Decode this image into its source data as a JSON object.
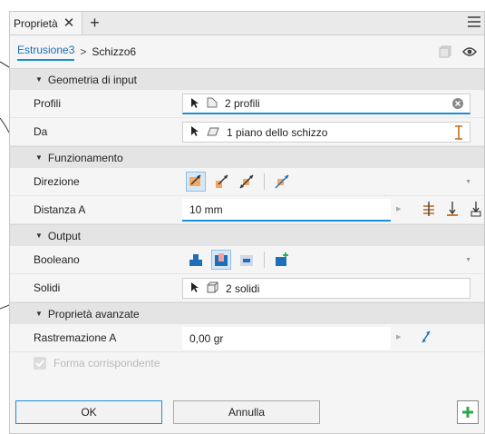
{
  "tab": {
    "title": "Proprietà"
  },
  "breadcrumb": {
    "parent": "Estrusione3",
    "separator": ">",
    "current": "Schizzo6"
  },
  "sections": {
    "input_geometry": "Geometria di input",
    "behavior": "Funzionamento",
    "output": "Output",
    "advanced": "Proprietà avanzate"
  },
  "input_geometry": {
    "profiles_label": "Profili",
    "profiles_value": "2 profili",
    "from_label": "Da",
    "from_value": "1 piano dello schizzo"
  },
  "behavior": {
    "direction_label": "Direzione",
    "distance_label": "Distanza A",
    "distance_value": "10 mm"
  },
  "output": {
    "boolean_label": "Booleano",
    "solids_label": "Solidi",
    "solids_value": "2 solidi"
  },
  "advanced": {
    "taper_label": "Rastremazione A",
    "taper_value": "0,00 gr",
    "match_shape_label": "Forma corrispondente"
  },
  "buttons": {
    "ok": "OK",
    "cancel": "Annulla"
  },
  "colors": {
    "accent": "#1a8fd6",
    "orange": "#e8812a",
    "blue": "#1f6fb8"
  }
}
